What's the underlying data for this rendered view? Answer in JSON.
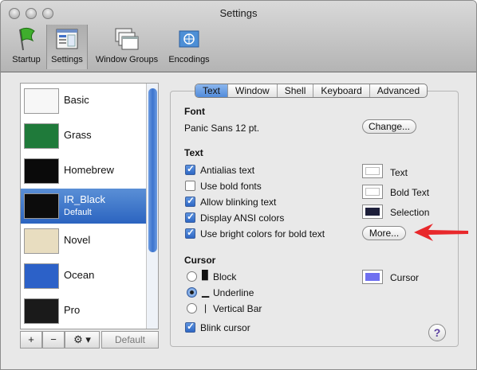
{
  "window": {
    "title": "Settings"
  },
  "toolbar": {
    "items": [
      {
        "label": "Startup",
        "icon": "flag-icon"
      },
      {
        "label": "Settings",
        "icon": "settings-icon"
      },
      {
        "label": "Window Groups",
        "icon": "window-groups-icon"
      },
      {
        "label": "Encodings",
        "icon": "encodings-icon"
      }
    ],
    "selected": "Settings"
  },
  "profiles": {
    "items": [
      {
        "name": "Basic"
      },
      {
        "name": "Grass"
      },
      {
        "name": "Homebrew"
      },
      {
        "name": "IR_Black",
        "subtitle": "Default"
      },
      {
        "name": "Novel"
      },
      {
        "name": "Ocean"
      },
      {
        "name": "Pro"
      }
    ],
    "selected": "IR_Black",
    "buttons": {
      "add": "+",
      "remove": "−",
      "gear": "⚙ ▾",
      "default": "Default"
    }
  },
  "tabs": [
    {
      "label": "Text"
    },
    {
      "label": "Window"
    },
    {
      "label": "Shell"
    },
    {
      "label": "Keyboard"
    },
    {
      "label": "Advanced"
    }
  ],
  "active_tab": "Text",
  "font": {
    "heading": "Font",
    "value": "Panic Sans 12 pt.",
    "change_button": "Change..."
  },
  "text": {
    "heading": "Text",
    "options": [
      {
        "label": "Antialias text",
        "checked": true
      },
      {
        "label": "Use bold fonts",
        "checked": false
      },
      {
        "label": "Allow blinking text",
        "checked": true
      },
      {
        "label": "Display ANSI colors",
        "checked": true
      },
      {
        "label": "Use bright colors for bold text",
        "checked": true
      }
    ],
    "colors": [
      {
        "label": "Text",
        "color": "#ffffff"
      },
      {
        "label": "Bold Text",
        "color": "#ffffff"
      },
      {
        "label": "Selection",
        "color": "#1d1f3a"
      }
    ],
    "more_button": "More..."
  },
  "cursor": {
    "heading": "Cursor",
    "options": [
      {
        "glyph": "█",
        "label": "Block",
        "selected": false
      },
      {
        "glyph": "▁",
        "label": "Underline",
        "selected": true
      },
      {
        "glyph": "|",
        "label": "Vertical Bar",
        "selected": false
      }
    ],
    "color_label": "Cursor",
    "color": "#6e6ff0",
    "blink_label": "Blink cursor",
    "blink_checked": true
  },
  "help_label": "?",
  "colors": {
    "accent": "#3c74cd",
    "arrow": "#e8282b"
  }
}
